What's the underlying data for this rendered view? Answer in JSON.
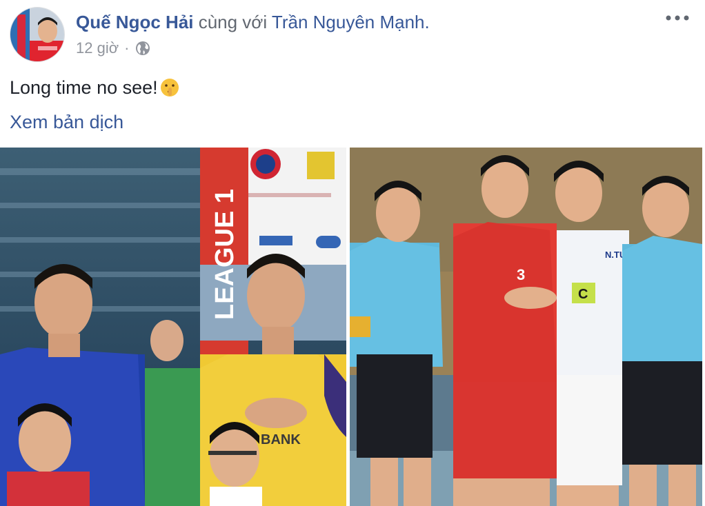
{
  "post": {
    "author_name": "Quế Ngọc Hải",
    "with_text": " cùng với ",
    "tagged_name": "Trần Nguyên Mạnh.",
    "timestamp": "12 giờ",
    "separator": "·",
    "privacy_icon": "globe-icon",
    "more_icon": "more-horizontal-icon",
    "text": "Long time no see!",
    "emoji_icon": "shushing-face-icon",
    "translate_label": "Xem bản dịch",
    "photos": [
      {
        "name": "photo-anthem",
        "banner_text": "LEAGUE 1",
        "shirt_text": "BANK"
      },
      {
        "name": "photo-captains",
        "player_number": "3",
        "captain_badge": "C",
        "shirt_name": "N.TUẤN"
      }
    ]
  },
  "colors": {
    "link": "#385898",
    "text": "#1d2129",
    "meta": "#90949c",
    "muted": "#616770"
  }
}
